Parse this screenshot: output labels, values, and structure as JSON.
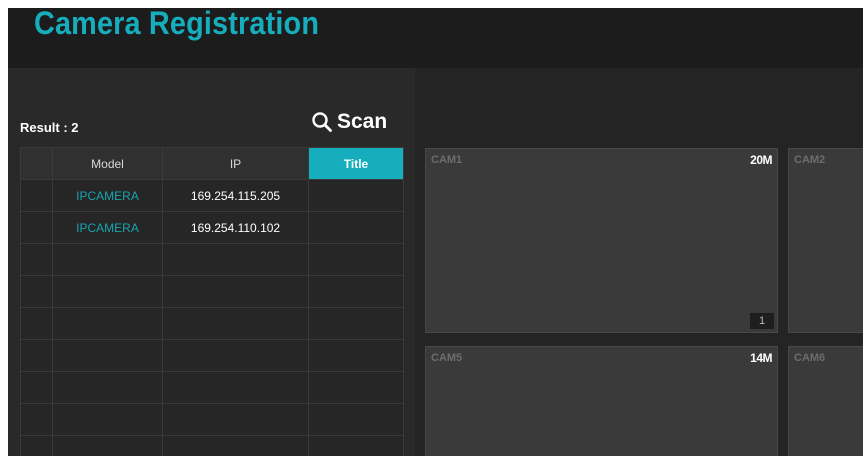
{
  "header": {
    "title": "Camera Registration"
  },
  "search": {
    "result_label": "Result : 2",
    "scan_label": "Scan"
  },
  "table": {
    "columns": [
      "",
      "Model",
      "IP",
      "Title"
    ],
    "active_column": "Title",
    "rows": [
      {
        "model": "IPCAMERA",
        "ip": "169.254.115.205",
        "title": ""
      },
      {
        "model": "IPCAMERA",
        "ip": "169.254.110.102",
        "title": ""
      },
      {
        "model": "",
        "ip": "",
        "title": ""
      },
      {
        "model": "",
        "ip": "",
        "title": ""
      },
      {
        "model": "",
        "ip": "",
        "title": ""
      },
      {
        "model": "",
        "ip": "",
        "title": ""
      },
      {
        "model": "",
        "ip": "",
        "title": ""
      },
      {
        "model": "",
        "ip": "",
        "title": ""
      },
      {
        "model": "",
        "ip": "",
        "title": ""
      }
    ]
  },
  "tiles": [
    {
      "name": "CAM1",
      "resolution": "20M",
      "index": "1"
    },
    {
      "name": "CAM2",
      "resolution": "",
      "index": ""
    },
    {
      "name": "CAM5",
      "resolution": "14M",
      "index": ""
    },
    {
      "name": "CAM6",
      "resolution": "",
      "index": ""
    }
  ],
  "colors": {
    "accent": "#16aebd",
    "model_text": "#1aa3b1",
    "background": "#232323"
  },
  "icons": {
    "scan": "search-icon"
  }
}
